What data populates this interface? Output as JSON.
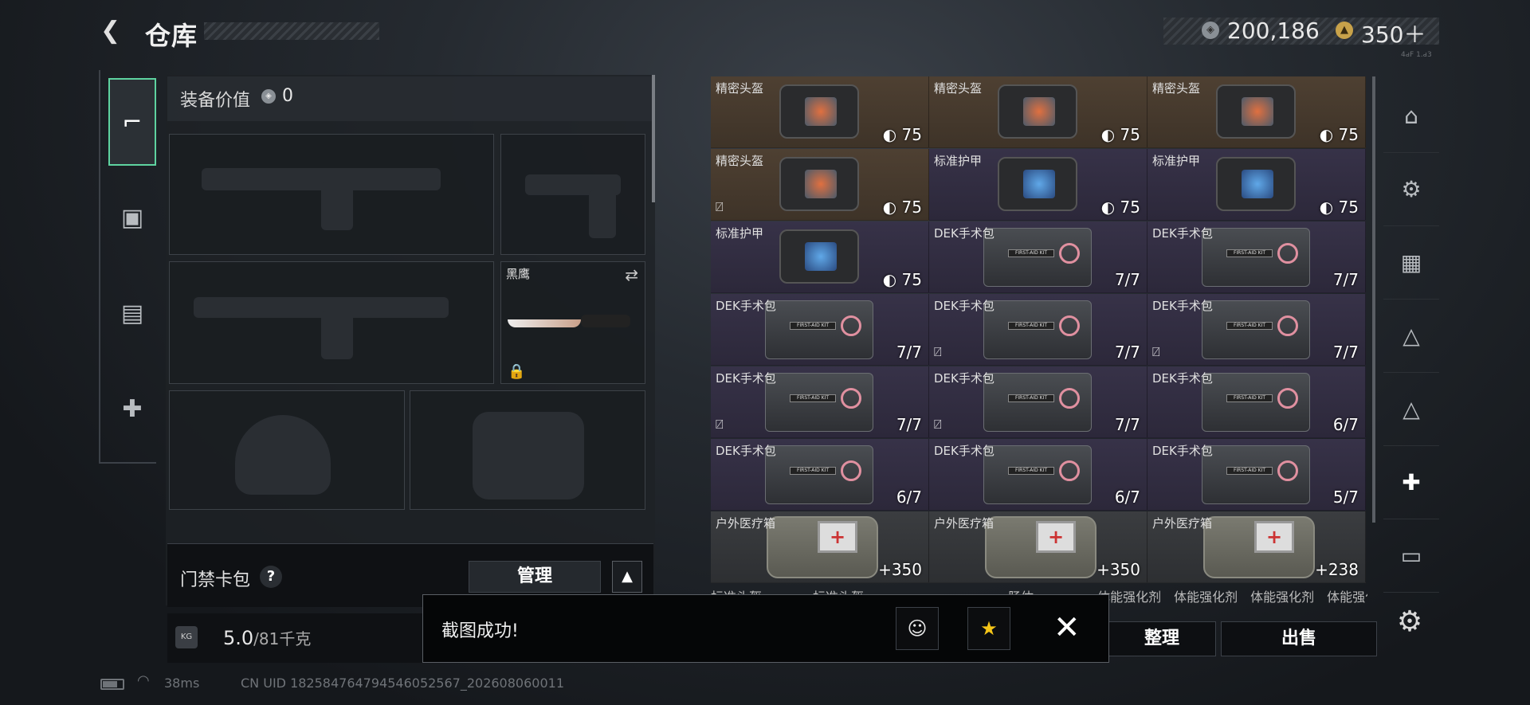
{
  "header": {
    "title": "仓库",
    "currency1": "200,186",
    "currency2": "350＋",
    "tiny_text": "4ԁF 1.ԁ3"
  },
  "left_panel": {
    "value_label": "装备价值",
    "value_amount": "0",
    "knife_name": "黑鹰",
    "card_pack_label": "门禁卡包",
    "manage_label": "管理",
    "weight_value": "5.0",
    "weight_max": "/81千克"
  },
  "grid": {
    "rows": [
      [
        {
          "name": "精密头盔",
          "val": "75",
          "kind": "helmet",
          "bg": "tan",
          "mark": false
        },
        {
          "name": "精密头盔",
          "val": "75",
          "kind": "helmet",
          "bg": "tan",
          "mark": false
        },
        {
          "name": "精密头盔",
          "val": "75",
          "kind": "helmet",
          "bg": "tan",
          "mark": false
        }
      ],
      [
        {
          "name": "精密头盔",
          "val": "75",
          "kind": "helmet",
          "bg": "tan",
          "mark": true
        },
        {
          "name": "标准护甲",
          "val": "75",
          "kind": "armor",
          "bg": "purple",
          "mark": false
        },
        {
          "name": "标准护甲",
          "val": "75",
          "kind": "armor",
          "bg": "purple",
          "mark": false
        }
      ],
      [
        {
          "name": "标准护甲",
          "val": "75",
          "kind": "armor",
          "bg": "purple",
          "mark": false
        },
        {
          "name": "DEK手术包",
          "val": "7/7",
          "kind": "kit",
          "bg": "purple",
          "mark": false
        },
        {
          "name": "DEK手术包",
          "val": "7/7",
          "kind": "kit",
          "bg": "purple",
          "mark": false
        }
      ],
      [
        {
          "name": "DEK手术包",
          "val": "7/7",
          "kind": "kit",
          "bg": "purple",
          "mark": false
        },
        {
          "name": "DEK手术包",
          "val": "7/7",
          "kind": "kit",
          "bg": "purple",
          "mark": true
        },
        {
          "name": "DEK手术包",
          "val": "7/7",
          "kind": "kit",
          "bg": "purple",
          "mark": true
        }
      ],
      [
        {
          "name": "DEK手术包",
          "val": "7/7",
          "kind": "kit",
          "bg": "purple",
          "mark": true
        },
        {
          "name": "DEK手术包",
          "val": "7/7",
          "kind": "kit",
          "bg": "purple",
          "mark": true
        },
        {
          "name": "DEK手术包",
          "val": "6/7",
          "kind": "kit",
          "bg": "purple",
          "mark": false
        }
      ],
      [
        {
          "name": "DEK手术包",
          "val": "6/7",
          "kind": "kit",
          "bg": "purple",
          "mark": false
        },
        {
          "name": "DEK手术包",
          "val": "6/7",
          "kind": "kit",
          "bg": "purple",
          "mark": false
        },
        {
          "name": "DEK手术包",
          "val": "5/7",
          "kind": "kit",
          "bg": "purple",
          "mark": false
        }
      ],
      [
        {
          "name": "户外医疗箱",
          "val": "+350",
          "kind": "box",
          "bg": "gray",
          "mark": false
        },
        {
          "name": "户外医疗箱",
          "val": "+350",
          "kind": "box",
          "bg": "gray",
          "mark": false
        },
        {
          "name": "户外医疗箱",
          "val": "+238",
          "kind": "box",
          "bg": "gray",
          "mark": false
        }
      ]
    ],
    "peek_text": "标准头盔　　　　标准头盔　　　　　　　　　　　 肠体　　　　　体能强化剂　体能强化剂　体能强化剂　体能强化剂"
  },
  "buttons": {
    "organize": "整理",
    "sell": "出售"
  },
  "toast": {
    "message": "截图成功!"
  },
  "status": {
    "ping": "38ms",
    "uid": "CN UID 1825847647945460525​67_202608060011",
    "battery_level": 0.75
  },
  "colors": {
    "accent": "#5ed3a0",
    "tan": "#4e4032",
    "purple": "#373248",
    "gray": "#3b3d40"
  },
  "icons": {
    "left_nav": [
      "pistol-icon",
      "backpack-icon",
      "vest-icon",
      "medkit-icon"
    ],
    "right_nav": [
      "safe-icon",
      "tier4-gear-icon",
      "tier4-folder-icon",
      "tier3-gear-icon",
      "tier3-chip-icon",
      "tier4-medkit-icon",
      "tier4-misc-icon"
    ]
  }
}
